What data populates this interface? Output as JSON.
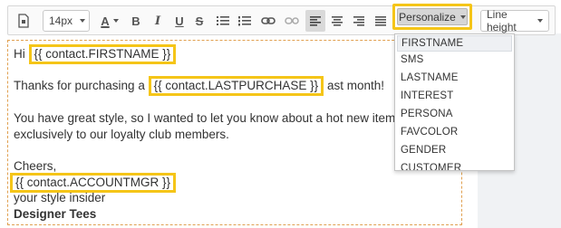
{
  "toolbar": {
    "font_size": "14px",
    "text_color_label": "A",
    "bold_label": "B",
    "italic_label": "I",
    "underline_label": "U",
    "strike_label": "S",
    "personalize_label": "Personalize",
    "line_height_label": "Line height"
  },
  "editor": {
    "line1_prefix": "Hi ",
    "token_firstname": "{{ contact.FIRSTNAME }}",
    "line2_prefix": "Thanks for purchasing a ",
    "token_lastpurchase": "{{ contact.LASTPURCHASE }}",
    "line2_suffix": " ast month!",
    "line3": "You have great style, so I wanted to let you know about a hot new item avail",
    "line4": "exclusively to our loyalty club members.",
    "line5": "Cheers,",
    "token_accountmgr": "{{ contact.ACCOUNTMGR }}",
    "line6": "your style insider",
    "line7": "Designer Tees"
  },
  "personalize_menu": {
    "items": [
      "FIRSTNAME",
      "SMS",
      "LASTNAME",
      "INTEREST",
      "PERSONA",
      "FAVCOLOR",
      "GENDER",
      "CUSTOMER"
    ]
  },
  "colors": {
    "highlight_border": "#f5c518",
    "editor_border": "#e0a050"
  }
}
